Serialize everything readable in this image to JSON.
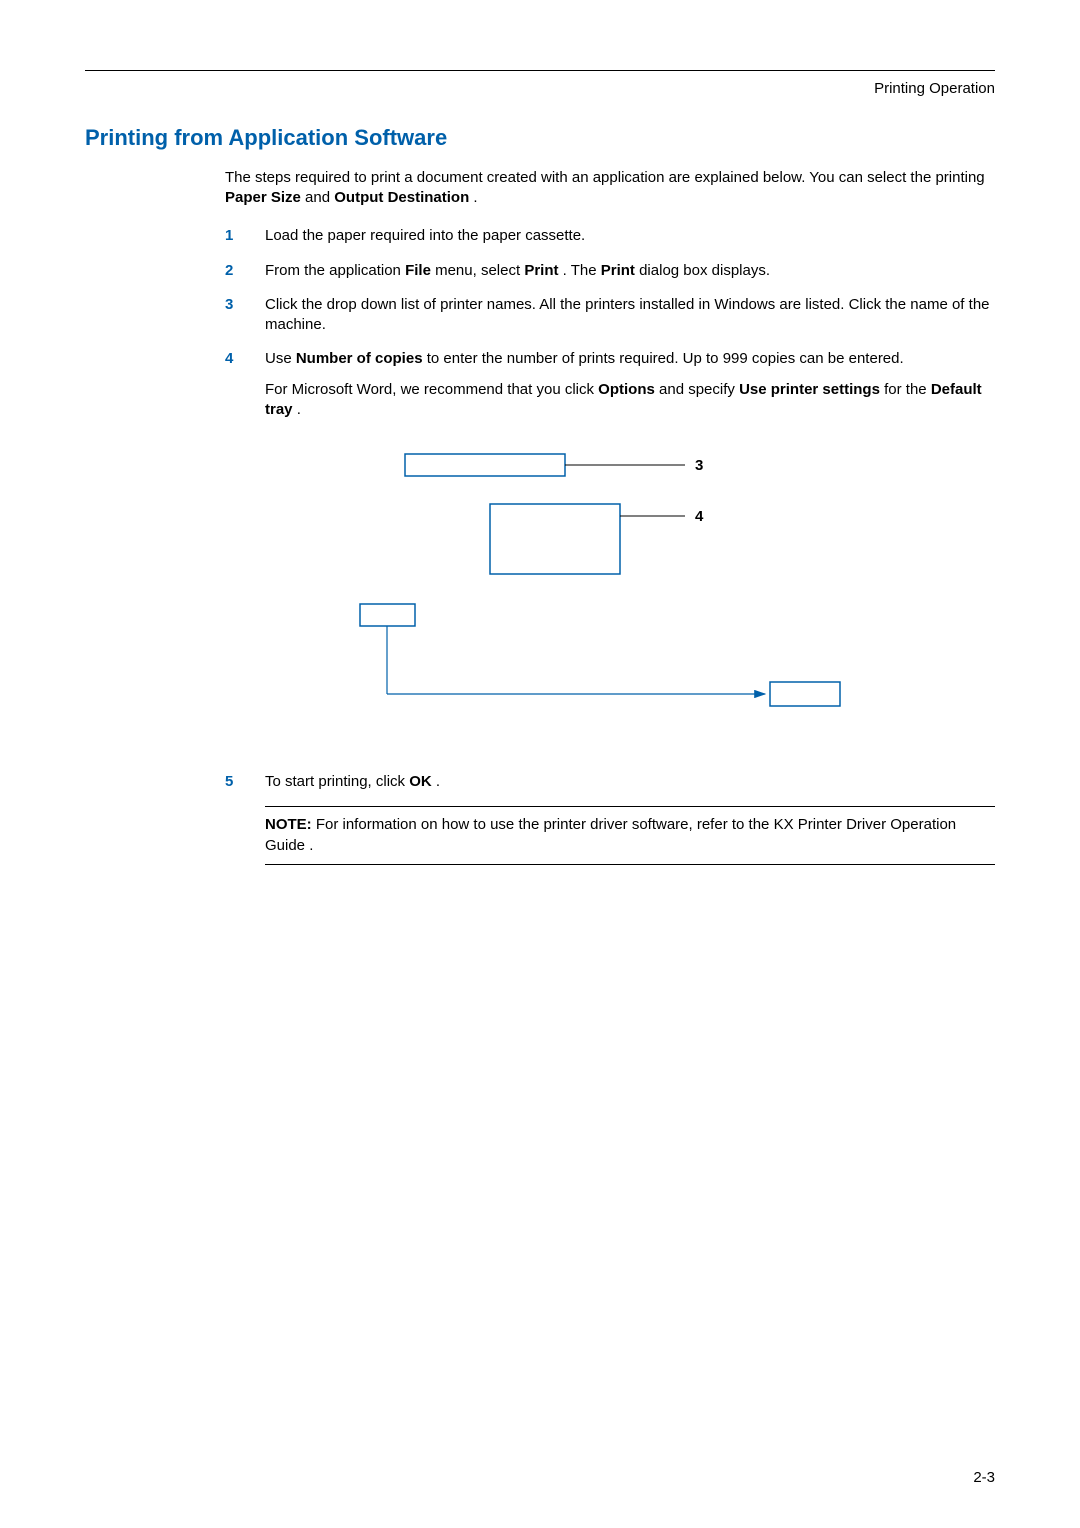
{
  "header": {
    "section": "Printing Operation"
  },
  "title": "Printing from Application Software",
  "intro": {
    "text_a": "The steps required to print a document created with an application are explained below. You can select the printing ",
    "bold_a": "Paper Size",
    "text_b": " and ",
    "bold_b": "Output Destination",
    "text_c": "."
  },
  "steps": [
    {
      "parts": [
        {
          "type": "text",
          "value": "Load the paper required into the paper cassette."
        }
      ]
    },
    {
      "parts": [
        {
          "type": "text",
          "value": "From the application "
        },
        {
          "type": "bold",
          "value": "File"
        },
        {
          "type": "text",
          "value": " menu, select "
        },
        {
          "type": "bold",
          "value": "Print"
        },
        {
          "type": "text",
          "value": ". The "
        },
        {
          "type": "bold",
          "value": "Print"
        },
        {
          "type": "text",
          "value": " dialog box displays."
        }
      ]
    },
    {
      "parts": [
        {
          "type": "text",
          "value": "Click the drop down list of printer names. All the printers installed in Windows are listed. Click the name of the machine."
        }
      ]
    },
    {
      "paragraphs": [
        [
          {
            "type": "text",
            "value": "Use "
          },
          {
            "type": "bold",
            "value": "Number of copies"
          },
          {
            "type": "text",
            "value": " to enter the number of prints required. Up to 999 copies can be entered."
          }
        ],
        [
          {
            "type": "text",
            "value": "For Microsoft Word, we recommend that you click "
          },
          {
            "type": "bold",
            "value": "Options"
          },
          {
            "type": "text",
            "value": " and specify "
          },
          {
            "type": "bold",
            "value": "Use printer settings"
          },
          {
            "type": "text",
            "value": " for the "
          },
          {
            "type": "bold",
            "value": "Default tray"
          },
          {
            "type": "text",
            "value": "."
          }
        ]
      ]
    },
    {
      "parts": [
        {
          "type": "text",
          "value": "To start printing, click "
        },
        {
          "type": "bold",
          "value": "OK"
        },
        {
          "type": "text",
          "value": "."
        }
      ]
    }
  ],
  "diagram": {
    "callouts": {
      "top": "3",
      "mid": "4"
    }
  },
  "note": {
    "lead": "NOTE:",
    "text_a": " For information on how to use the printer driver software, refer to the ",
    "ref": "KX Printer Driver Operation Guide",
    "text_b": "."
  },
  "page_number": "2-3"
}
